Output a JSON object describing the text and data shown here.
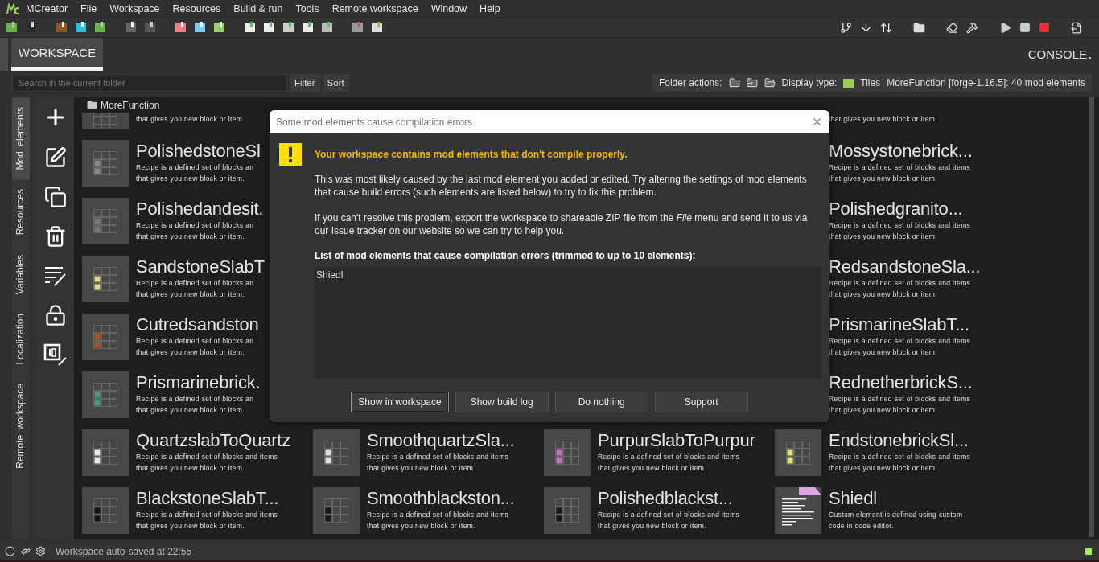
{
  "menu_bar": {
    "items": [
      "MCreator",
      "File",
      "Workspace",
      "Resources",
      "Build & run",
      "Tools",
      "Remote workspace",
      "Window",
      "Help"
    ]
  },
  "tabs": [
    {
      "label": "WORKSPACE",
      "selected": true
    }
  ],
  "console_tab": {
    "label": "CONSOLE"
  },
  "search": {
    "placeholder": "Search in the current folder"
  },
  "search_buttons": [
    "Filter",
    "Sort"
  ],
  "folder_bar": {
    "folder_actions_label": "Folder actions:",
    "display_type_label": "Display type:",
    "display_type": "Tiles",
    "workspace_info": "MoreFunction [forge-1.16.5]: 40 mod elements"
  },
  "side_tabs": [
    {
      "label": "Mod elements",
      "selected": true
    },
    {
      "label": "Resources",
      "selected": false
    },
    {
      "label": "Variables",
      "selected": false
    },
    {
      "label": "Localization",
      "selected": false
    },
    {
      "label": "Remote workspace",
      "selected": false
    }
  ],
  "breadcrumb": "MoreFunction",
  "rows": [
    {
      "kind": "cut",
      "tiles": [
        {
          "kind": "recipe",
          "description": [
            "that gives you new block or item."
          ]
        },
        {
          "kind": "recipe",
          "description": [
            "that gives you new block or item."
          ]
        }
      ]
    },
    {
      "kind": "behind",
      "tiles": [
        {
          "kind": "recipe",
          "color": "#8a8a8a",
          "title": "PolishedstoneSl",
          "description": [
            "Recipe is a defined set of blocks an",
            "that gives you new block or item."
          ]
        },
        {
          "kind": "recipe",
          "title": "Mossystonebrick...",
          "description": [
            "Recipe is a defined set of blocks and items",
            "that gives you new block or item."
          ]
        }
      ]
    },
    {
      "kind": "behind",
      "tiles": [
        {
          "kind": "recipe",
          "color": "#7a7a7a",
          "title": "Polishedandesit.",
          "description": [
            "Recipe is a defined set of blocks an",
            "that gives you new block or item."
          ]
        },
        {
          "kind": "recipe",
          "title": "Polishedgranito...",
          "description": [
            "Recipe is a defined set of blocks and items",
            "that gives you new block or item."
          ]
        }
      ]
    },
    {
      "kind": "behind",
      "tiles": [
        {
          "kind": "recipe",
          "color": "#e0d890",
          "title": "SandstoneSlabT",
          "description": [
            "Recipe is a defined set of blocks an",
            "that gives you new block or item."
          ]
        },
        {
          "kind": "recipe",
          "title": "RedsandstoneSla...",
          "description": [
            "Recipe is a defined set of blocks and items",
            "that gives you new block or item."
          ]
        }
      ]
    },
    {
      "kind": "behind",
      "tiles": [
        {
          "kind": "recipe",
          "color": "#b0502a",
          "title": "Cutredsandston",
          "description": [
            "Recipe is a defined set of blocks an",
            "that gives you new block or item."
          ]
        },
        {
          "kind": "recipe",
          "title": "PrismarineSlabT...",
          "description": [
            "Recipe is a defined set of blocks and items",
            "that gives you new block or item."
          ]
        }
      ]
    },
    {
      "kind": "behind",
      "tiles": [
        {
          "kind": "recipe",
          "color": "#4a9a88",
          "title": "Prismarinebrick.",
          "description": [
            "Recipe is a defined set of blocks an",
            "that gives you new block or item."
          ]
        },
        {
          "kind": "recipe",
          "title": "RednetherbrickS...",
          "description": [
            "Recipe is a defined set of blocks and items",
            "that gives you new block or item."
          ]
        }
      ]
    },
    {
      "kind": "full",
      "tiles": [
        {
          "kind": "recipe",
          "color": "#e8e8e8",
          "title": "QuartzslabToQuartz",
          "description": [
            "Recipe is a defined set of blocks and items",
            "that gives you new block or item."
          ]
        },
        {
          "kind": "recipe",
          "color": "#e0e0e0",
          "title": "SmoothquartzSla...",
          "description": [
            "Recipe is a defined set of blocks and items",
            "that gives you new block or item."
          ]
        },
        {
          "kind": "recipe",
          "color": "#c070c0",
          "title": "PurpurSlabToPurpur",
          "description": [
            "Recipe is a defined set of blocks and items",
            "that gives you new block or item."
          ]
        },
        {
          "kind": "recipe",
          "color": "#e0e080",
          "title": "EndstonebrickSl...",
          "description": [
            "Recipe is a defined set of blocks and items",
            "that gives you new block or item."
          ]
        }
      ]
    },
    {
      "kind": "full",
      "tiles": [
        {
          "kind": "recipe",
          "color": "#181818",
          "title": "BlackstoneSlabT...",
          "description": [
            "Recipe is a defined set of blocks and items",
            "that gives you new block or item."
          ]
        },
        {
          "kind": "recipe",
          "color": "#181818",
          "title": "Smoothblackston...",
          "description": [
            "Recipe is a defined set of blocks and items",
            "that gives you new block or item."
          ]
        },
        {
          "kind": "recipe",
          "color": "#181818",
          "title": "Polishedblackst...",
          "description": [
            "Recipe is a defined set of blocks and items",
            "that gives you new block or item."
          ]
        },
        {
          "kind": "custom-code",
          "title": "Shiedl",
          "description": [
            "Custom element is defined using custom",
            "code in code editor."
          ]
        }
      ]
    }
  ],
  "dialog": {
    "title": "Some mod elements cause compilation errors",
    "heading": "Your workspace contains mod elements that don't compile properly.",
    "paragraphs": [
      "This was most likely caused by the last mod element you added or edited. Try altering the settings of mod elements that cause build errors (such elements are listed below) to try to fix this problem.",
      "If you can't resolve this problem, export the workspace to shareable ZIP file from the *File* menu and send it to us via our Issue tracker on our website so we can try to help you."
    ],
    "list_label": "List of mod elements that cause compilation errors (trimmed to up to 10 elements):",
    "list_items": [
      "Shiedl"
    ],
    "buttons": [
      {
        "label": "Show in workspace",
        "selected": true
      },
      {
        "label": "Show build log",
        "selected": false
      },
      {
        "label": "Do nothing",
        "selected": false
      },
      {
        "label": "Support",
        "selected": false
      }
    ]
  },
  "status_bar": {
    "text": "Workspace auto-saved at 22:55"
  }
}
